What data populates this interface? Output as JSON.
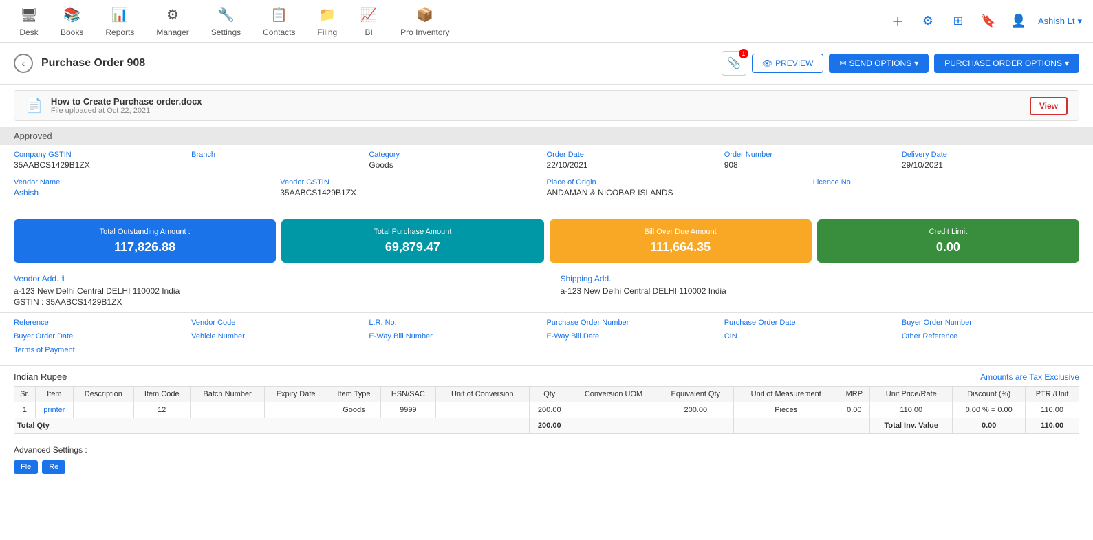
{
  "nav": {
    "items": [
      {
        "id": "desk",
        "label": "Desk",
        "icon": "🖥"
      },
      {
        "id": "books",
        "label": "Books",
        "icon": "📚"
      },
      {
        "id": "reports",
        "label": "Reports",
        "icon": "📊"
      },
      {
        "id": "manager",
        "label": "Manager",
        "icon": "⚙"
      },
      {
        "id": "settings",
        "label": "Settings",
        "icon": "🔧"
      },
      {
        "id": "contacts",
        "label": "Contacts",
        "icon": "📋"
      },
      {
        "id": "filing",
        "label": "Filing",
        "icon": "📁"
      },
      {
        "id": "bi",
        "label": "BI",
        "icon": "📈"
      },
      {
        "id": "pro_inventory",
        "label": "Pro Inventory",
        "icon": "📦"
      }
    ],
    "user": "Ashish Lt"
  },
  "page": {
    "title": "Purchase Order 908",
    "back_label": "‹",
    "status": "Approved"
  },
  "file_notification": {
    "file_name": "How to Create Purchase order.docx",
    "file_date": "File uploaded at Oct 22, 2021",
    "view_label": "View"
  },
  "buttons": {
    "preview": "PREVIEW",
    "send_options": "SEND OPTIONS",
    "purchase_order_options": "PURCHASE ORDER OPTIONS"
  },
  "company_fields": {
    "company_gstin_label": "Company GSTIN",
    "company_gstin_value": "35AABCS1429B1ZX",
    "branch_label": "Branch",
    "branch_value": "",
    "category_label": "Category",
    "category_value": "Goods",
    "order_date_label": "Order Date",
    "order_date_value": "22/10/2021",
    "order_number_label": "Order Number",
    "order_number_value": "908",
    "delivery_date_label": "Delivery Date",
    "delivery_date_value": "29/10/2021"
  },
  "vendor_fields": {
    "vendor_name_label": "Vendor Name",
    "vendor_name_value": "Ashish",
    "vendor_gstin_label": "Vendor GSTIN",
    "vendor_gstin_value": "35AABCS1429B1ZX",
    "place_of_origin_label": "Place of Origin",
    "place_of_origin_value": "ANDAMAN & NICOBAR ISLANDS",
    "licence_no_label": "Licence No",
    "licence_no_value": ""
  },
  "summary": {
    "outstanding_label": "Total Outstanding Amount :",
    "outstanding_value": "117,826.88",
    "purchase_label": "Total Purchase Amount",
    "purchase_value": "69,879.47",
    "overdue_label": "Bill Over Due Amount",
    "overdue_value": "111,664.35",
    "credit_label": "Credit Limit",
    "credit_value": "0.00"
  },
  "addresses": {
    "vendor_add_label": "Vendor Add.",
    "vendor_add_value": "a-123 New Delhi Central DELHI 110002 India",
    "vendor_gstin_label": "GSTIN : 35AABCS1429B1ZX",
    "shipping_add_label": "Shipping Add.",
    "shipping_add_value": "a-123 New Delhi Central DELHI 110002 India"
  },
  "ref_fields": [
    {
      "label": "Reference",
      "value": ""
    },
    {
      "label": "Vendor Code",
      "value": ""
    },
    {
      "label": "L.R. No.",
      "value": ""
    },
    {
      "label": "Purchase Order Number",
      "value": ""
    },
    {
      "label": "Purchase Order Date",
      "value": ""
    },
    {
      "label": "Buyer Order Number",
      "value": ""
    },
    {
      "label": "Buyer Order Date",
      "value": ""
    },
    {
      "label": "Vehicle Number",
      "value": ""
    },
    {
      "label": "E-Way Bill Number",
      "value": ""
    },
    {
      "label": "E-Way Bill Date",
      "value": ""
    },
    {
      "label": "CIN",
      "value": ""
    },
    {
      "label": "Other Reference",
      "value": ""
    },
    {
      "label": "Terms of Payment",
      "value": ""
    }
  ],
  "table": {
    "currency": "Indian Rupee",
    "tax_note": "Amounts are Tax Exclusive",
    "columns": [
      "Sr.",
      "Item",
      "Description",
      "Item Code",
      "Batch Number",
      "Expiry Date",
      "Item Type",
      "HSN/SAC",
      "Unit of Conversion",
      "Qty",
      "Conversion UOM",
      "Equivalent Qty",
      "Unit of Measurement",
      "MRP",
      "Unit Price/Rate",
      "Discount (%)",
      "PTR /Unit"
    ],
    "rows": [
      {
        "sr": "1",
        "item": "printer",
        "description": "",
        "item_code": "12",
        "batch_number": "",
        "expiry_date": "",
        "item_type": "Goods",
        "hsn_sac": "9999",
        "unit_of_conversion": "",
        "qty": "200.00",
        "conversion_uom": "",
        "equivalent_qty": "200.00",
        "unit_of_measurement": "Pieces",
        "mrp": "0.00",
        "unit_price_rate": "110.00",
        "discount": "0.00 % = 0.00",
        "ptr_unit": "110.00"
      }
    ],
    "total_qty_label": "Total Qty",
    "total_qty_value": "200.00",
    "total_inv_label": "Total Inv. Value",
    "total_inv_value": "0.00",
    "total_ptr_value": "110.00"
  },
  "advanced": {
    "label": "Advanced Settings :",
    "btn1": "Fle",
    "btn2": "Re"
  }
}
